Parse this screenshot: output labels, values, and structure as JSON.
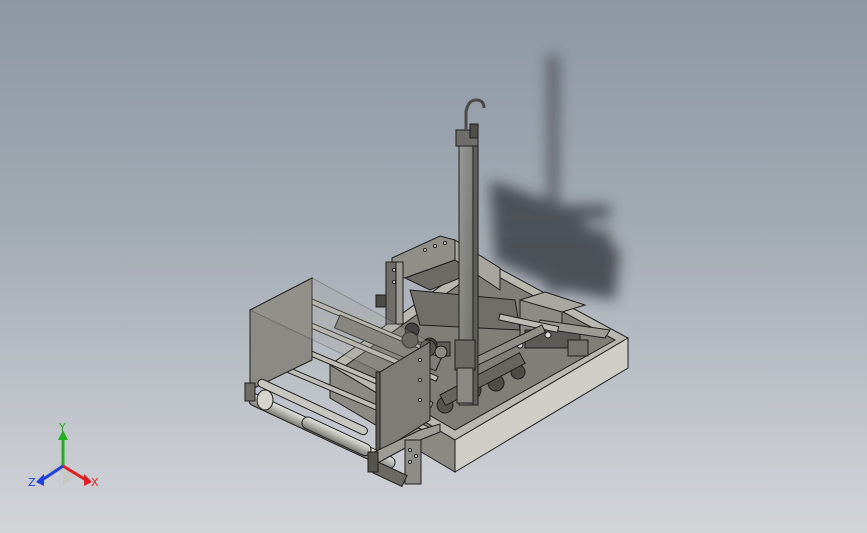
{
  "viewport": {
    "background_top": "#8d97a2",
    "background_bottom": "#d2d4d8"
  },
  "model": {
    "kind": "3d-cad-machine-assembly",
    "display_style": "shaded-with-edges",
    "shadow": "floor-shadow"
  },
  "triad": {
    "x_label": "X",
    "y_label": "Y",
    "z_label": "Z",
    "x_color": "#e02020",
    "y_color": "#20b020",
    "z_color": "#2040e0"
  }
}
